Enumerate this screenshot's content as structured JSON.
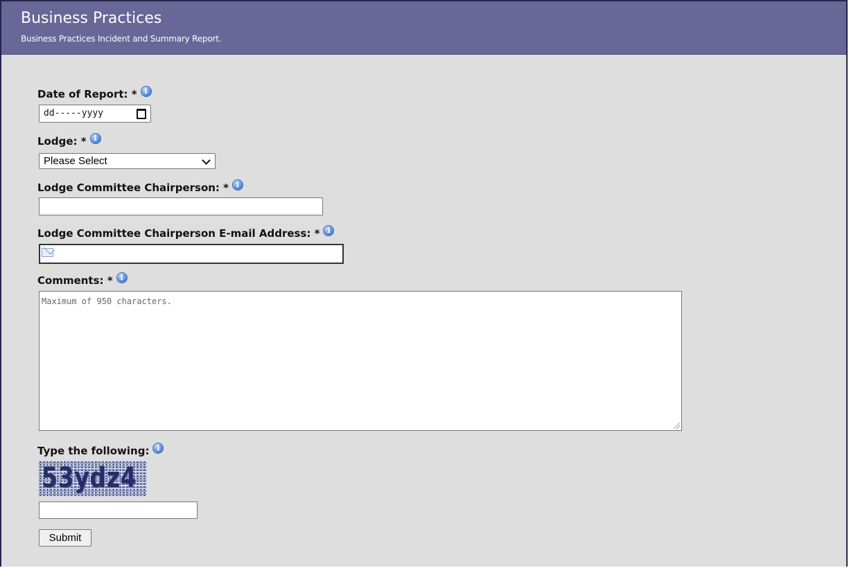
{
  "header": {
    "title": "Business Practices",
    "subtitle": "Business Practices Incident and Summary Report."
  },
  "form": {
    "date_label": "Date of Report: *",
    "date_placeholder": "dd-----yyyy",
    "lodge_label": "Lodge: *",
    "lodge_selected": "Please Select",
    "chair_label": "Lodge Committee Chairperson: *",
    "chair_value": "",
    "email_label": "Lodge Committee Chairperson E-mail Address: *",
    "email_value": "",
    "comments_label": "Comments: *",
    "comments_placeholder": "Maximum of 950 characters.",
    "captcha_label": "Type the following:",
    "captcha_text": "53ydz4",
    "captcha_value": "",
    "submit_label": "Submit"
  },
  "icons": {
    "info": "info-icon",
    "calendar": "calendar-icon",
    "dropdown": "chevron-down-icon",
    "email": "envelope-icon"
  },
  "colors": {
    "header_bg": "#686797",
    "page_bg": "#dedede",
    "frame_border": "#26234a"
  }
}
